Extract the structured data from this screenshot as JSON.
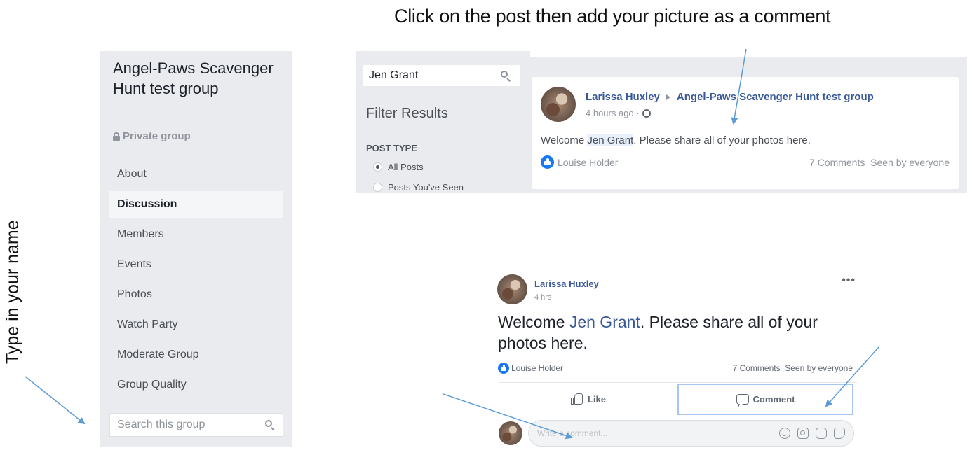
{
  "annotations": {
    "top_instruction": "Click on the post then add your picture as a comment",
    "left_instruction": "Type in your name",
    "arrow_color": "#5b9bd5"
  },
  "sidebar": {
    "group_name": "Angel-Paws Scavenger Hunt test group",
    "privacy": "Private group",
    "items": [
      {
        "label": "About",
        "active": false
      },
      {
        "label": "Discussion",
        "active": true
      },
      {
        "label": "Members",
        "active": false
      },
      {
        "label": "Events",
        "active": false
      },
      {
        "label": "Photos",
        "active": false
      },
      {
        "label": "Watch Party",
        "active": false
      },
      {
        "label": "Moderate Group",
        "active": false
      },
      {
        "label": "Group Quality",
        "active": false
      }
    ],
    "search_placeholder": "Search this group"
  },
  "results": {
    "search_value": "Jen Grant",
    "filter_title": "Filter Results",
    "post_type_heading": "POST TYPE",
    "options": [
      {
        "label": "All Posts",
        "selected": true
      },
      {
        "label": "Posts You've Seen",
        "selected": false
      }
    ],
    "card": {
      "author": "Larissa Huxley",
      "group": "Angel-Paws Scavenger Hunt test group",
      "time": "4 hours ago ·",
      "body_prefix": "Welcome ",
      "body_highlight": "Jen Grant",
      "body_suffix": ". Please share all of your photos here.",
      "liker": "Louise Holder",
      "comments": "7 Comments",
      "seen": "Seen by everyone"
    }
  },
  "post": {
    "author": "Larissa Huxley",
    "time": "4 hrs",
    "more": "•••",
    "body_prefix": "Welcome ",
    "body_link": "Jen Grant",
    "body_suffix": ". Please share all of your photos here.",
    "liker": "Louise Holder",
    "comments": "7 Comments",
    "seen": "Seen by everyone",
    "like_label": "Like",
    "comment_label": "Comment",
    "comment_placeholder": "Write a comment..."
  }
}
